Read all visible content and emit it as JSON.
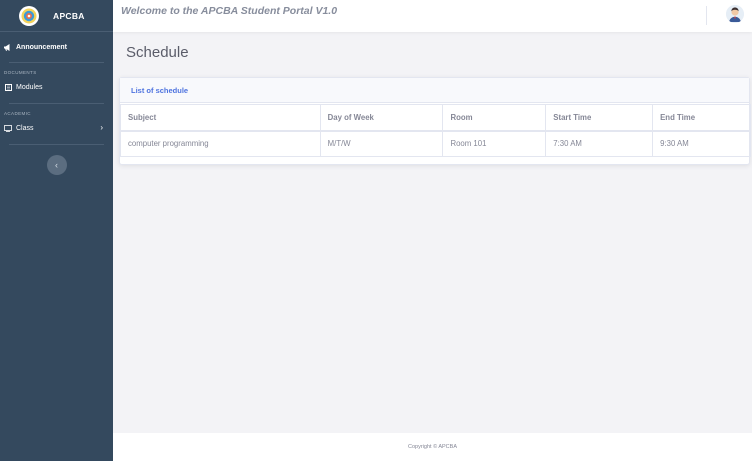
{
  "brand": {
    "name": "APCBA",
    "logo_icon": "school-logo-icon"
  },
  "sidebar": {
    "items": [
      {
        "label": "Announcement",
        "icon": "megaphone-icon"
      },
      {
        "section": "DOCUMENTS"
      },
      {
        "label": "Modules",
        "icon": "book-icon"
      },
      {
        "section": "ACADEMIC"
      },
      {
        "label": "Class",
        "icon": "window-icon",
        "has_chevron": true
      }
    ],
    "toggle_label": "‹"
  },
  "topbar": {
    "welcome": "Welcome to the APCBA Student Portal V1.0",
    "avatar_icon": "user-avatar-icon"
  },
  "page": {
    "title": "Schedule"
  },
  "card": {
    "title": "List of schedule",
    "columns": [
      "Subject",
      "Day of Week",
      "Room",
      "Start Time",
      "End Time"
    ],
    "rows": [
      [
        "computer programming",
        "M/T/W",
        "Room 101",
        "7:30 AM",
        "9:30 AM"
      ]
    ]
  },
  "footer": {
    "copyright": "Copyright © APCBA"
  },
  "colors": {
    "sidebar_bg": "#34495e",
    "accent": "#4e73df",
    "page_bg": "#f3f3f6"
  }
}
